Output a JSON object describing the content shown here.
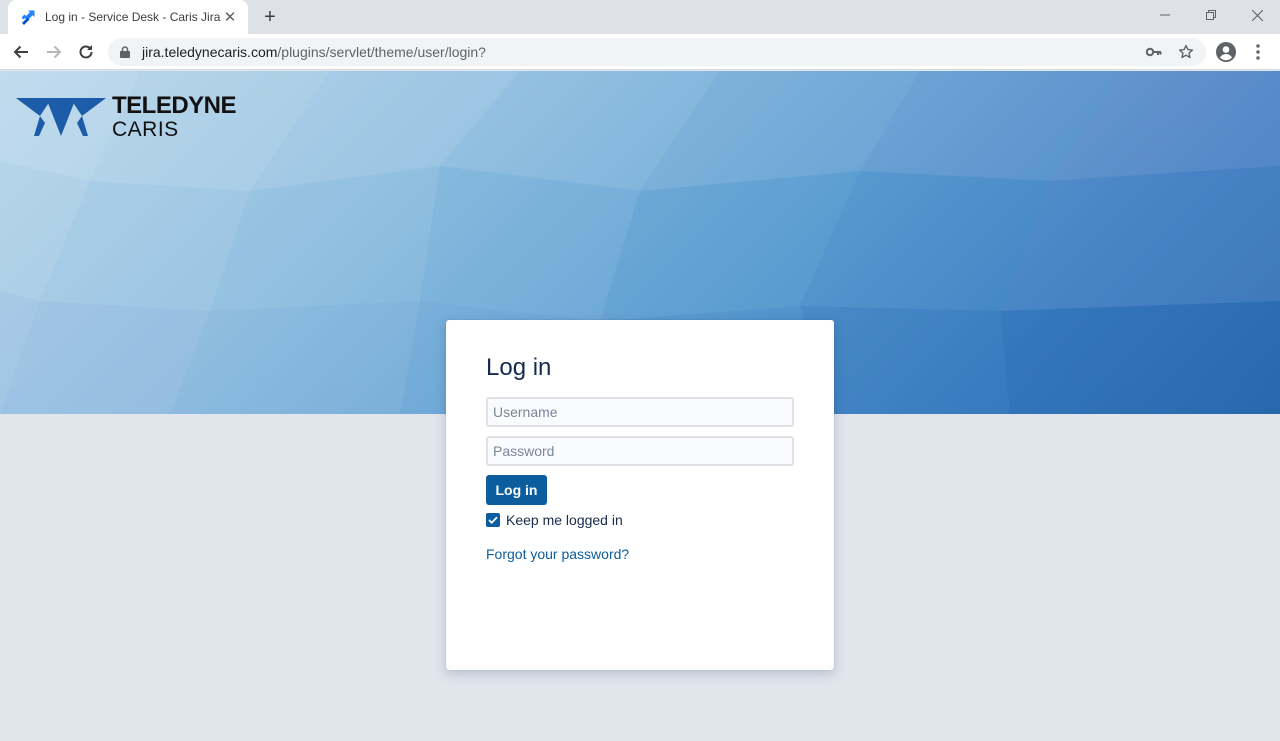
{
  "browser": {
    "tab_title": "Log in - Service Desk - Caris Jira",
    "url_host": "jira.teledynecaris.com",
    "url_path": "/plugins/servlet/theme/user/login?"
  },
  "brand": {
    "line1": "TELEDYNE",
    "line2": "CARIS"
  },
  "login": {
    "heading": "Log in",
    "username_placeholder": "Username",
    "password_placeholder": "Password",
    "submit_label": "Log in",
    "keep_logged_in_label": "Keep me logged in",
    "keep_logged_in_checked": true,
    "forgot_label": "Forgot your password?"
  },
  "colors": {
    "accent": "#0b5d9e",
    "page_bg": "#e1e5ec",
    "heading": "#172b4d"
  }
}
